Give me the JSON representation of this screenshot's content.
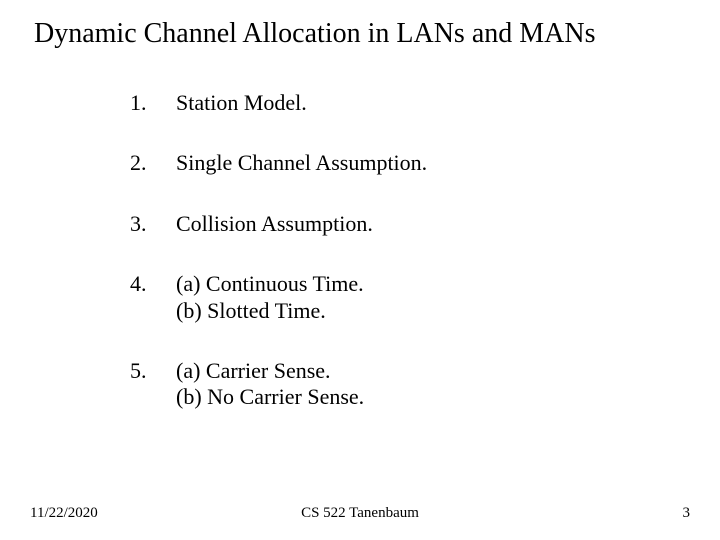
{
  "title": "Dynamic Channel Allocation in LANs and MANs",
  "items": [
    {
      "num": "1.",
      "text": "Station Model."
    },
    {
      "num": "2.",
      "text": "Single Channel Assumption."
    },
    {
      "num": "3.",
      "text": "Collision Assumption."
    },
    {
      "num": "4.",
      "text": "(a) Continuous Time.\n(b) Slotted Time."
    },
    {
      "num": "5.",
      "text": "(a) Carrier Sense.\n(b) No Carrier Sense."
    }
  ],
  "footer": {
    "date": "11/22/2020",
    "center": "CS 522 Tanenbaum",
    "page": "3"
  }
}
